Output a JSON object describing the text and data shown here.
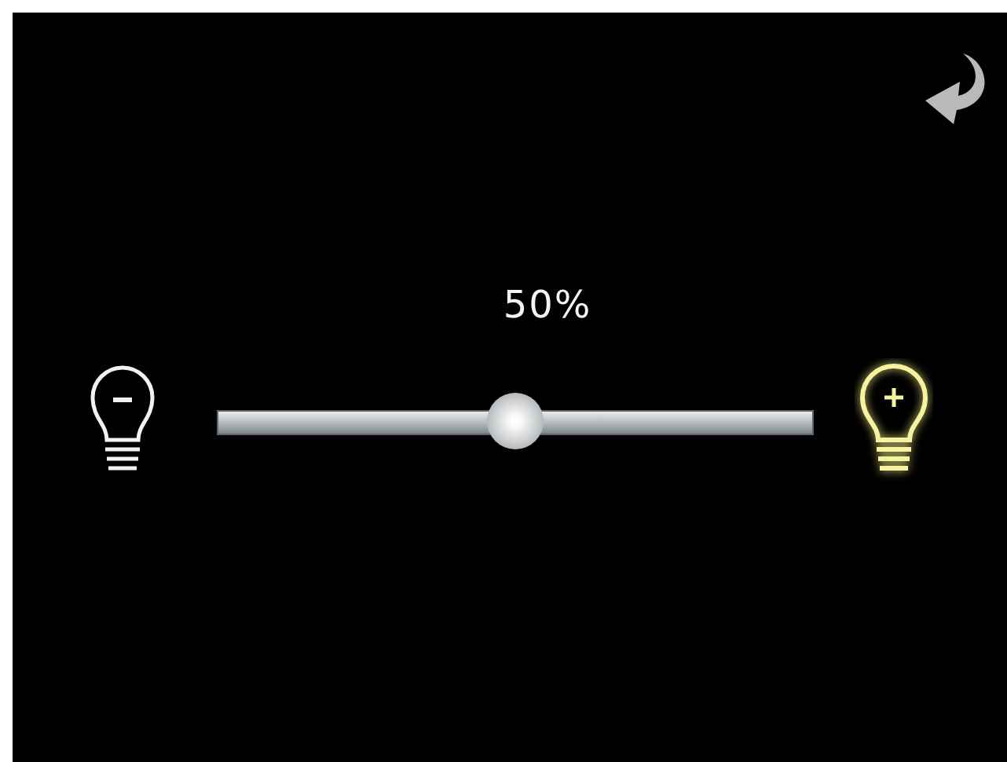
{
  "brightness": {
    "reading": "50%",
    "level": 0.5
  }
}
